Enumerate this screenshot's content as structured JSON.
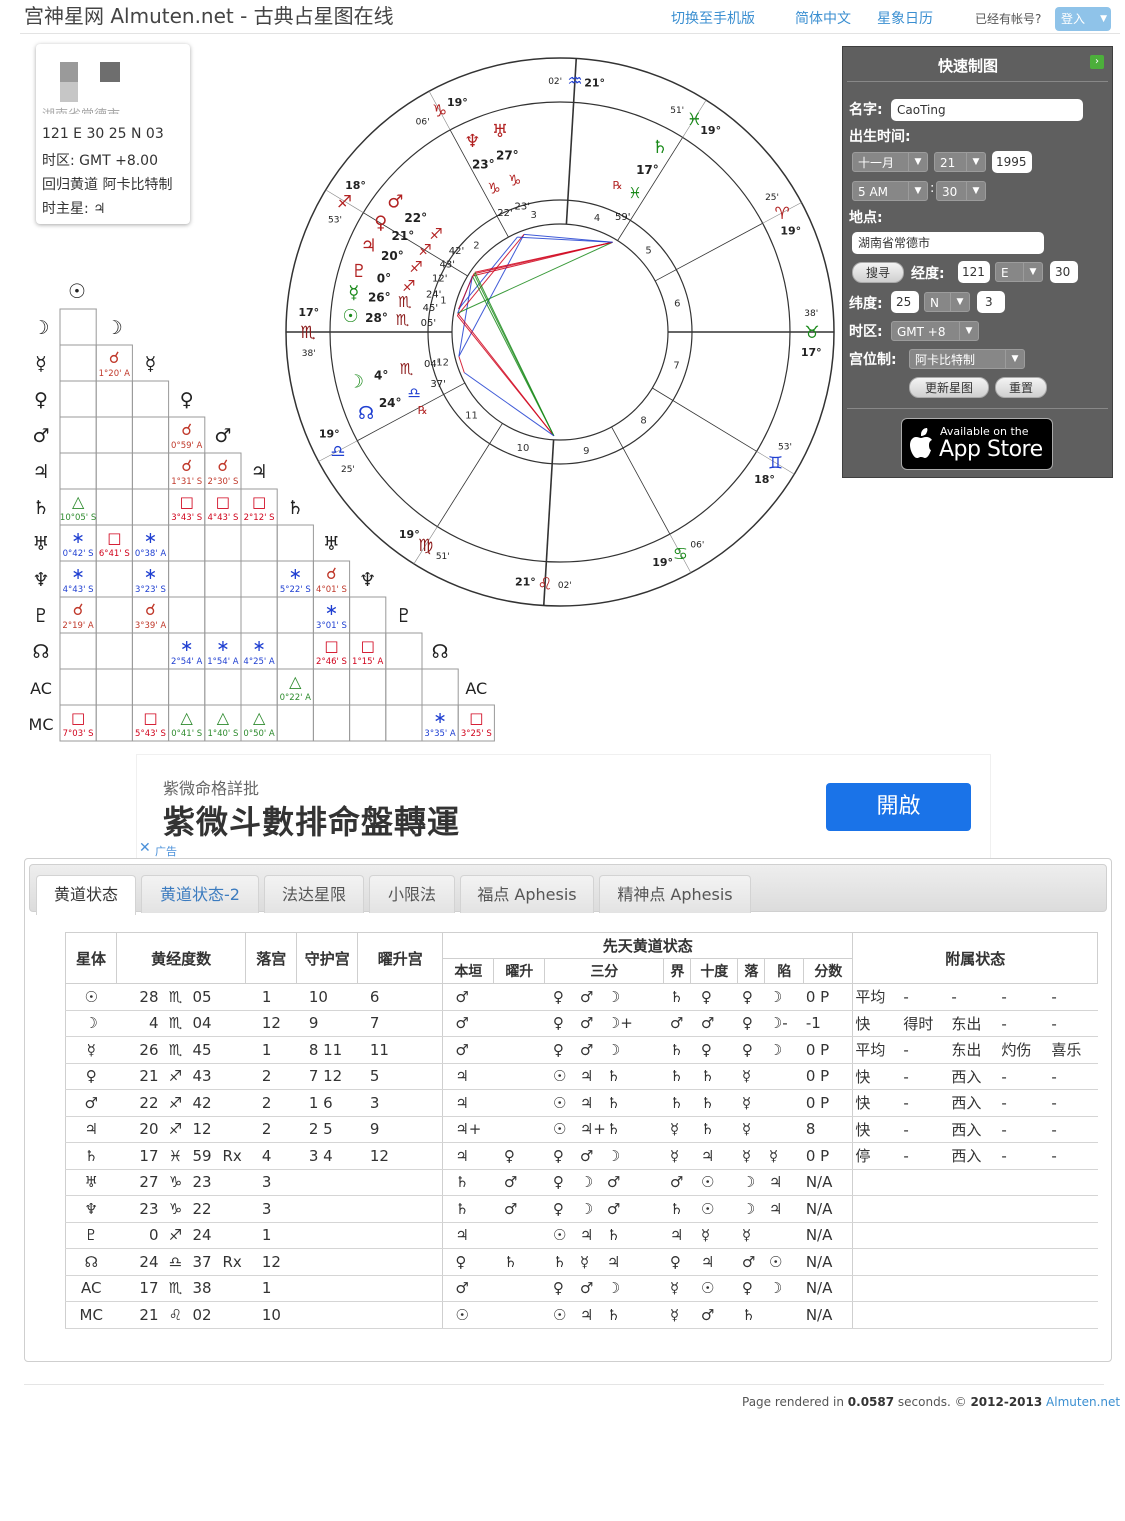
{
  "header": {
    "site_title": "宫神星网 Almuten.net - 古典占星图在线",
    "links": [
      "切换至手机版",
      "简体中文",
      "星象日历"
    ],
    "account_question": "已经有帐号?",
    "login_label": "登入"
  },
  "info": {
    "partial_place": "湖南省常德市",
    "coords": "121 E 30  25 N 03",
    "timezone": "时区: GMT +8.00",
    "system": "回归黄道 阿卡比特制",
    "hour_ruler_label": "时主星:",
    "hour_ruler_glyph": "♃"
  },
  "aspect_grid": {
    "bodies": [
      "☉",
      "☽",
      "☿",
      "♀",
      "♂",
      "♃",
      "♄",
      "♅",
      "♆",
      "♇",
      "☊",
      "AC",
      "MC"
    ],
    "cells": [
      {
        "r": 2,
        "c": 1,
        "sym": "☌",
        "txt": "1°20' A",
        "col": "#c0392b"
      },
      {
        "r": 4,
        "c": 3,
        "sym": "☌",
        "txt": "0°59' A",
        "col": "#c0392b"
      },
      {
        "r": 5,
        "c": 3,
        "sym": "☌",
        "txt": "1°31' S",
        "col": "#c0392b"
      },
      {
        "r": 5,
        "c": 4,
        "sym": "☌",
        "txt": "2°30' S",
        "col": "#c0392b"
      },
      {
        "r": 6,
        "c": 0,
        "sym": "△",
        "txt": "10°05' S",
        "col": "#2e8b2e"
      },
      {
        "r": 6,
        "c": 3,
        "sym": "□",
        "txt": "3°43' S",
        "col": "#d0021b"
      },
      {
        "r": 6,
        "c": 4,
        "sym": "□",
        "txt": "4°43' S",
        "col": "#d0021b"
      },
      {
        "r": 6,
        "c": 5,
        "sym": "□",
        "txt": "2°12' S",
        "col": "#d0021b"
      },
      {
        "r": 7,
        "c": 0,
        "sym": "∗",
        "txt": "0°42' S",
        "col": "#1f3fd1"
      },
      {
        "r": 7,
        "c": 1,
        "sym": "□",
        "txt": "6°41' S",
        "col": "#d0021b"
      },
      {
        "r": 7,
        "c": 2,
        "sym": "∗",
        "txt": "0°38' A",
        "col": "#1f3fd1"
      },
      {
        "r": 8,
        "c": 0,
        "sym": "∗",
        "txt": "4°43' S",
        "col": "#1f3fd1"
      },
      {
        "r": 8,
        "c": 2,
        "sym": "∗",
        "txt": "3°23' S",
        "col": "#1f3fd1"
      },
      {
        "r": 8,
        "c": 6,
        "sym": "∗",
        "txt": "5°22' S",
        "col": "#1f3fd1"
      },
      {
        "r": 8,
        "c": 7,
        "sym": "☌",
        "txt": "4°01' S",
        "col": "#c0392b"
      },
      {
        "r": 9,
        "c": 0,
        "sym": "☌",
        "txt": "2°19' A",
        "col": "#c0392b"
      },
      {
        "r": 9,
        "c": 2,
        "sym": "☌",
        "txt": "3°39' A",
        "col": "#c0392b"
      },
      {
        "r": 9,
        "c": 7,
        "sym": "∗",
        "txt": "3°01' S",
        "col": "#1f3fd1"
      },
      {
        "r": 10,
        "c": 3,
        "sym": "∗",
        "txt": "2°54' A",
        "col": "#1f3fd1"
      },
      {
        "r": 10,
        "c": 4,
        "sym": "∗",
        "txt": "1°54' A",
        "col": "#1f3fd1"
      },
      {
        "r": 10,
        "c": 5,
        "sym": "∗",
        "txt": "4°25' A",
        "col": "#1f3fd1"
      },
      {
        "r": 10,
        "c": 7,
        "sym": "□",
        "txt": "2°46' S",
        "col": "#d0021b"
      },
      {
        "r": 10,
        "c": 8,
        "sym": "□",
        "txt": "1°15' A",
        "col": "#d0021b"
      },
      {
        "r": 11,
        "c": 6,
        "sym": "△",
        "txt": "0°22' A",
        "col": "#2e8b2e"
      },
      {
        "r": 12,
        "c": 0,
        "sym": "□",
        "txt": "7°03' S",
        "col": "#d0021b"
      },
      {
        "r": 12,
        "c": 2,
        "sym": "□",
        "txt": "5°43' S",
        "col": "#d0021b"
      },
      {
        "r": 12,
        "c": 3,
        "sym": "△",
        "txt": "0°41' S",
        "col": "#2e8b2e"
      },
      {
        "r": 12,
        "c": 4,
        "sym": "△",
        "txt": "1°40' S",
        "col": "#2e8b2e"
      },
      {
        "r": 12,
        "c": 5,
        "sym": "△",
        "txt": "0°50' A",
        "col": "#2e8b2e"
      },
      {
        "r": 12,
        "c": 10,
        "sym": "∗",
        "txt": "3°35' A",
        "col": "#1f3fd1"
      },
      {
        "r": 12,
        "c": 11,
        "sym": "□",
        "txt": "3°25' S",
        "col": "#d0021b"
      }
    ]
  },
  "wheel": {
    "houses": [
      "1",
      "2",
      "3",
      "4",
      "5",
      "6",
      "7",
      "8",
      "9",
      "10",
      "11",
      "12"
    ],
    "cusps": [
      {
        "deg": "17°",
        "sign": "♏",
        "min": "38'"
      },
      {
        "deg": "18°",
        "sign": "♐",
        "min": "53'"
      },
      {
        "deg": "19°",
        "sign": "♑",
        "min": "06'"
      },
      {
        "deg": "21°",
        "sign": "♒",
        "min": "02'"
      },
      {
        "deg": "19°",
        "sign": "♓",
        "min": "51'"
      },
      {
        "deg": "19°",
        "sign": "♈",
        "min": "25'"
      },
      {
        "deg": "17°",
        "sign": "♉",
        "min": "38'"
      },
      {
        "deg": "18°",
        "sign": "♊",
        "min": "53'"
      },
      {
        "deg": "19°",
        "sign": "♋",
        "min": "06'"
      },
      {
        "deg": "21°",
        "sign": "♌",
        "min": "02'"
      },
      {
        "deg": "19°",
        "sign": "♍",
        "min": "51'"
      },
      {
        "deg": "19°",
        "sign": "♎",
        "min": "25'"
      }
    ],
    "planets": [
      {
        "glyph": "☊",
        "deg": "24°",
        "sign": "♎",
        "min": "37'",
        "retro": "℞"
      },
      {
        "glyph": "☽",
        "deg": "4°",
        "sign": "♏",
        "min": "04'",
        "retro": ""
      },
      {
        "glyph": "☿",
        "deg": "26°",
        "sign": "♏",
        "min": "45'",
        "retro": ""
      },
      {
        "glyph": "☉",
        "deg": "28°",
        "sign": "♏",
        "min": "05'",
        "retro": ""
      },
      {
        "glyph": "♇",
        "deg": "0°",
        "sign": "♐",
        "min": "24'",
        "retro": ""
      },
      {
        "glyph": "♃",
        "deg": "20°",
        "sign": "♐",
        "min": "12'",
        "retro": ""
      },
      {
        "glyph": "♀",
        "deg": "21°",
        "sign": "♐",
        "min": "43'",
        "retro": ""
      },
      {
        "glyph": "♂",
        "deg": "22°",
        "sign": "♐",
        "min": "42'",
        "retro": ""
      },
      {
        "glyph": "♆",
        "deg": "23°",
        "sign": "♑",
        "min": "22'",
        "retro": ""
      },
      {
        "glyph": "♅",
        "deg": "27°",
        "sign": "♑",
        "min": "23'",
        "retro": ""
      },
      {
        "glyph": "♄",
        "deg": "17°",
        "sign": "♓",
        "min": "59'",
        "retro": "℞"
      }
    ]
  },
  "quick_chart": {
    "title": "快速制图",
    "name_label": "名字:",
    "name_value": "CaoTing",
    "birth_label": "出生时间:",
    "month": "十一月",
    "day": "21",
    "year": "1995",
    "hour": "5 AM",
    "minute": "30",
    "place_label": "地点:",
    "place_value": "湖南省常德市",
    "search_label": "搜寻",
    "lon_label": "经度:",
    "lon_deg": "121",
    "lon_dir": "E",
    "lon_min": "30",
    "lat_label": "纬度:",
    "lat_deg": "25",
    "lat_dir": "N",
    "lat_min": "3",
    "tz_label": "时区:",
    "tz_value": "GMT +8",
    "house_label": "宫位制:",
    "house_value": "阿卡比特制",
    "update_label": "更新星图",
    "reset_label": "重置",
    "appstore_small": "Available on the",
    "appstore_big": "App Store"
  },
  "ad": {
    "small": "紫微命格詳批",
    "big": "紫微斗數排命盤轉運",
    "cta": "開啟",
    "ad_label": "广告"
  },
  "tabs": [
    "黄道状态",
    "黄道状态-2",
    "法达星限",
    "小限法",
    "福点 Aphesis",
    "精神点 Aphesis"
  ],
  "table": {
    "headers": [
      "星体",
      "黄经度数",
      "落宫",
      "守护宫",
      "曜升宫",
      "先天黄道状态",
      "附属状态"
    ],
    "subheaders": [
      "本垣",
      "曜升",
      "三分",
      "界",
      "十度",
      "落",
      "陷",
      "分数"
    ],
    "rows": [
      {
        "p": "☉",
        "deg": "28",
        "sign": "♏",
        "min": "05",
        "rx": "",
        "house": "1",
        "rules": "10",
        "exalt": "6",
        "dom": "♂",
        "exa": "",
        "tri": [
          "♀",
          "♂",
          "☽"
        ],
        "term": "♄",
        "face": "♀",
        "det": "♀",
        "fall": "☽",
        "score": "0 P",
        "sp": "平均",
        "a1": "-",
        "a2": "-",
        "a3": "-",
        "a4": "-"
      },
      {
        "p": "☽",
        "deg": "4",
        "sign": "♏",
        "min": "04",
        "rx": "",
        "house": "12",
        "rules": "9",
        "exalt": "7",
        "dom": "♂",
        "exa": "",
        "tri": [
          "♀",
          "♂",
          "☽+"
        ],
        "term": "♂",
        "face": "♂",
        "det": "♀",
        "fall": "☽-",
        "score": "-1",
        "sp": "快",
        "a1": "得时",
        "a2": "东出",
        "a3": "-",
        "a4": "-"
      },
      {
        "p": "☿",
        "deg": "26",
        "sign": "♏",
        "min": "45",
        "rx": "",
        "house": "1",
        "rules": "8 11",
        "exalt": "11",
        "dom": "♂",
        "exa": "",
        "tri": [
          "♀",
          "♂",
          "☽"
        ],
        "term": "♄",
        "face": "♀",
        "det": "♀",
        "fall": "☽",
        "score": "0 P",
        "sp": "平均",
        "a1": "-",
        "a2": "东出",
        "a3": "灼伤",
        "a4": "喜乐"
      },
      {
        "p": "♀",
        "deg": "21",
        "sign": "♐",
        "min": "43",
        "rx": "",
        "house": "2",
        "rules": "7 12",
        "exalt": "5",
        "dom": "♃",
        "exa": "",
        "tri": [
          "☉",
          "♃",
          "♄"
        ],
        "term": "♄",
        "face": "♄",
        "det": "☿",
        "fall": "",
        "score": "0 P",
        "sp": "快",
        "a1": "-",
        "a2": "西入",
        "a3": "-",
        "a4": "-"
      },
      {
        "p": "♂",
        "deg": "22",
        "sign": "♐",
        "min": "42",
        "rx": "",
        "house": "2",
        "rules": "1 6",
        "exalt": "3",
        "dom": "♃",
        "exa": "",
        "tri": [
          "☉",
          "♃",
          "♄"
        ],
        "term": "♄",
        "face": "♄",
        "det": "☿",
        "fall": "",
        "score": "0 P",
        "sp": "快",
        "a1": "-",
        "a2": "西入",
        "a3": "-",
        "a4": "-"
      },
      {
        "p": "♃",
        "deg": "20",
        "sign": "♐",
        "min": "12",
        "rx": "",
        "house": "2",
        "rules": "2 5",
        "exalt": "9",
        "dom": "♃+",
        "exa": "",
        "tri": [
          "☉",
          "♃+",
          "♄"
        ],
        "term": "☿",
        "face": "♄",
        "det": "☿",
        "fall": "",
        "score": "8",
        "sp": "快",
        "a1": "-",
        "a2": "西入",
        "a3": "-",
        "a4": "-"
      },
      {
        "p": "♄",
        "deg": "17",
        "sign": "♓",
        "min": "59",
        "rx": "Rx",
        "house": "4",
        "rules": "3 4",
        "exalt": "12",
        "dom": "♃",
        "exa": "♀",
        "tri": [
          "♀",
          "♂",
          "☽"
        ],
        "term": "☿",
        "face": "♃",
        "det": "☿",
        "fall": "☿",
        "score": "0 P",
        "sp": "停",
        "a1": "-",
        "a2": "西入",
        "a3": "-",
        "a4": "-"
      },
      {
        "p": "♅",
        "deg": "27",
        "sign": "♑",
        "min": "23",
        "rx": "",
        "house": "3",
        "rules": "",
        "exalt": "",
        "dom": "♄",
        "exa": "♂",
        "tri": [
          "♀",
          "☽",
          "♂"
        ],
        "term": "♂",
        "face": "☉",
        "det": "☽",
        "fall": "♃",
        "score": "N/A",
        "sp": "",
        "a1": "",
        "a2": "",
        "a3": "",
        "a4": ""
      },
      {
        "p": "♆",
        "deg": "23",
        "sign": "♑",
        "min": "22",
        "rx": "",
        "house": "3",
        "rules": "",
        "exalt": "",
        "dom": "♄",
        "exa": "♂",
        "tri": [
          "♀",
          "☽",
          "♂"
        ],
        "term": "♄",
        "face": "☉",
        "det": "☽",
        "fall": "♃",
        "score": "N/A",
        "sp": "",
        "a1": "",
        "a2": "",
        "a3": "",
        "a4": ""
      },
      {
        "p": "♇",
        "deg": "0",
        "sign": "♐",
        "min": "24",
        "rx": "",
        "house": "1",
        "rules": "",
        "exalt": "",
        "dom": "♃",
        "exa": "",
        "tri": [
          "☉",
          "♃",
          "♄"
        ],
        "term": "♃",
        "face": "☿",
        "det": "☿",
        "fall": "",
        "score": "N/A",
        "sp": "",
        "a1": "",
        "a2": "",
        "a3": "",
        "a4": ""
      },
      {
        "p": "☊",
        "deg": "24",
        "sign": "♎",
        "min": "37",
        "rx": "Rx",
        "house": "12",
        "rules": "",
        "exalt": "",
        "dom": "♀",
        "exa": "♄",
        "tri": [
          "♄",
          "☿",
          "♃"
        ],
        "term": "♀",
        "face": "♃",
        "det": "♂",
        "fall": "☉",
        "score": "N/A",
        "sp": "",
        "a1": "",
        "a2": "",
        "a3": "",
        "a4": ""
      },
      {
        "p": "AC",
        "deg": "17",
        "sign": "♏",
        "min": "38",
        "rx": "",
        "house": "1",
        "rules": "",
        "exalt": "",
        "dom": "♂",
        "exa": "",
        "tri": [
          "♀",
          "♂",
          "☽"
        ],
        "term": "☿",
        "face": "☉",
        "det": "♀",
        "fall": "☽",
        "score": "N/A",
        "sp": "",
        "a1": "",
        "a2": "",
        "a3": "",
        "a4": ""
      },
      {
        "p": "MC",
        "deg": "21",
        "sign": "♌",
        "min": "02",
        "rx": "",
        "house": "10",
        "rules": "",
        "exalt": "",
        "dom": "☉",
        "exa": "",
        "tri": [
          "☉",
          "♃",
          "♄"
        ],
        "term": "☿",
        "face": "♂",
        "det": "♄",
        "fall": "",
        "score": "N/A",
        "sp": "",
        "a1": "",
        "a2": "",
        "a3": "",
        "a4": ""
      }
    ]
  },
  "footer": {
    "pre": "Page rendered in",
    "time": "0.0587",
    "mid": "seconds. ©",
    "years": "2012-2013",
    "site": "Almuten.net"
  }
}
